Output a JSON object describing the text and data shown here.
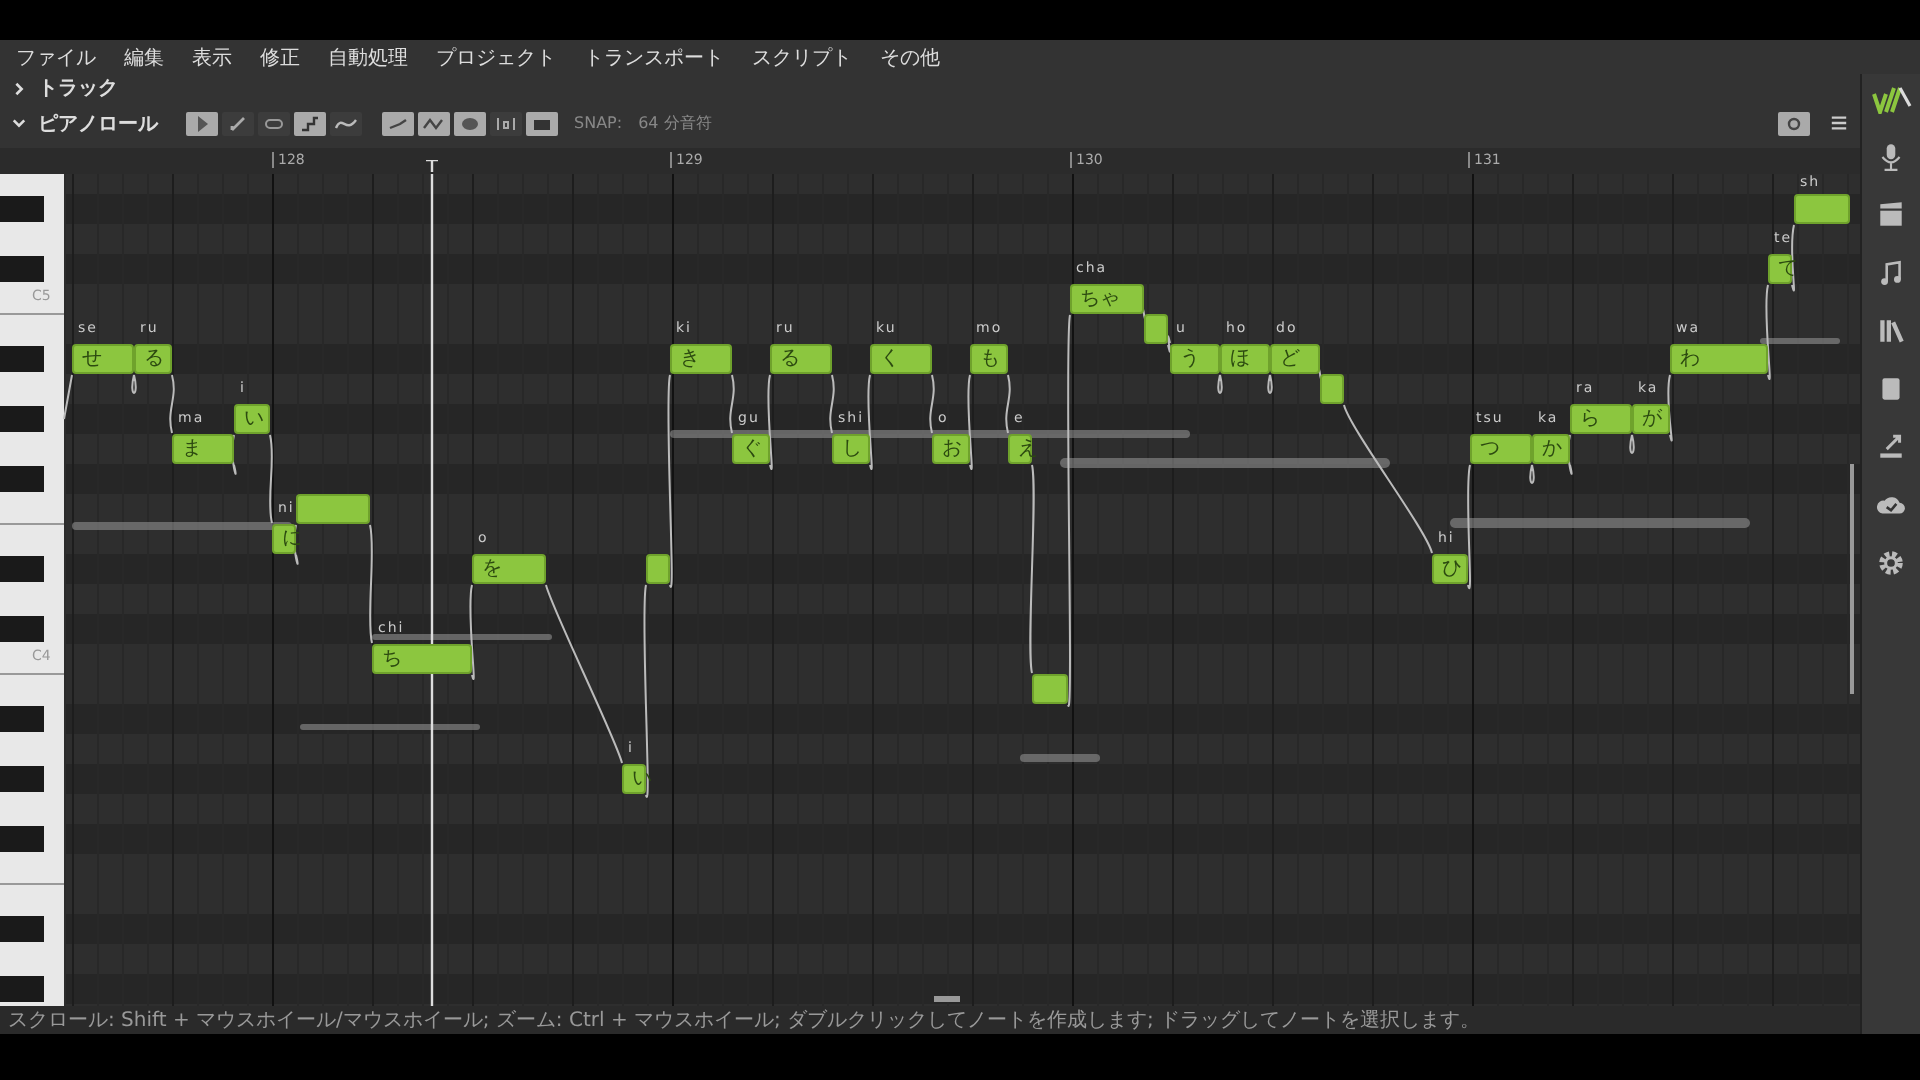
{
  "menu": [
    "ファイル",
    "編集",
    "表示",
    "修正",
    "自動処理",
    "プロジェクト",
    "トランスポート",
    "スクリプト",
    "その他"
  ],
  "panels": [
    {
      "title": "トラック",
      "expanded": false
    },
    {
      "title": "ピアノロール",
      "expanded": true
    }
  ],
  "toolbar": {
    "tools": [
      {
        "kind": "cursor",
        "selected": true
      },
      {
        "kind": "pencil",
        "selected": false
      },
      {
        "kind": "capsule",
        "selected": false
      },
      {
        "kind": "steps",
        "selected": true
      },
      {
        "kind": "curve",
        "selected": false
      },
      {
        "kind": "line",
        "selected": true
      },
      {
        "kind": "wave",
        "selected": true
      },
      {
        "kind": "blob",
        "selected": true
      },
      {
        "kind": "bracket",
        "selected": false
      },
      {
        "kind": "clapper",
        "selected": true
      }
    ],
    "snap_label": "SNAP:",
    "snap_value": "64 分音符",
    "view_toggle_selected": true
  },
  "ruler": [
    "128",
    "129",
    "130",
    "131"
  ],
  "keyboard": {
    "labels": [
      "C5",
      "C4"
    ]
  },
  "notes": [
    {
      "kind": "syllable",
      "lyric": "se",
      "text": "せ"
    },
    {
      "kind": "syllable",
      "lyric": "ru",
      "text": "る"
    },
    {
      "kind": "syllable",
      "lyric": "ma",
      "text": "ま"
    },
    {
      "kind": "syllable",
      "lyric": "i",
      "text": "い"
    },
    {
      "kind": "syllable",
      "lyric": "ni",
      "text": "に"
    },
    {
      "kind": "blank"
    },
    {
      "kind": "syllable",
      "lyric": "chi",
      "text": "ち"
    },
    {
      "kind": "syllable",
      "lyric": "o",
      "text": "を"
    },
    {
      "kind": "syllable",
      "lyric": "i",
      "text": "い"
    },
    {
      "kind": "blank"
    },
    {
      "kind": "syllable",
      "lyric": "ki",
      "text": "き"
    },
    {
      "kind": "syllable",
      "lyric": "gu",
      "text": "ぐ"
    },
    {
      "kind": "syllable",
      "lyric": "ru",
      "text": "る"
    },
    {
      "kind": "syllable",
      "lyric": "shi",
      "text": "し"
    },
    {
      "kind": "syllable",
      "lyric": "ku",
      "text": "く"
    },
    {
      "kind": "syllable",
      "lyric": "o",
      "text": "お"
    },
    {
      "kind": "syllable",
      "lyric": "mo",
      "text": "も"
    },
    {
      "kind": "syllable",
      "lyric": "e",
      "text": "え"
    },
    {
      "kind": "blank"
    },
    {
      "kind": "syllable",
      "lyric": "cha",
      "text": "ちゃ"
    },
    {
      "kind": "blank"
    },
    {
      "kind": "syllable",
      "lyric": "u",
      "text": "う"
    },
    {
      "kind": "syllable",
      "lyric": "ho",
      "text": "ほ"
    },
    {
      "kind": "syllable",
      "lyric": "do",
      "text": "ど"
    },
    {
      "kind": "blank"
    },
    {
      "kind": "syllable",
      "lyric": "hi",
      "text": "ひ"
    },
    {
      "kind": "syllable",
      "lyric": "tsu",
      "text": "つ"
    },
    {
      "kind": "syllable",
      "lyric": "ka",
      "text": "か"
    },
    {
      "kind": "syllable",
      "lyric": "ra",
      "text": "ら"
    },
    {
      "kind": "syllable",
      "lyric": "ka",
      "text": "が"
    },
    {
      "kind": "syllable",
      "lyric": "wa",
      "text": "わ"
    },
    {
      "kind": "syllable",
      "lyric": "te",
      "text": "て"
    },
    {
      "kind": "syllable",
      "lyric": "sh"
    }
  ],
  "status_bar": "スクロール: Shift + マウスホイール/マウスホイール; ズーム: Ctrl + マウスホイール; ダブルクリックしてノートを作成します; ドラッグしてノートを選択します。"
}
